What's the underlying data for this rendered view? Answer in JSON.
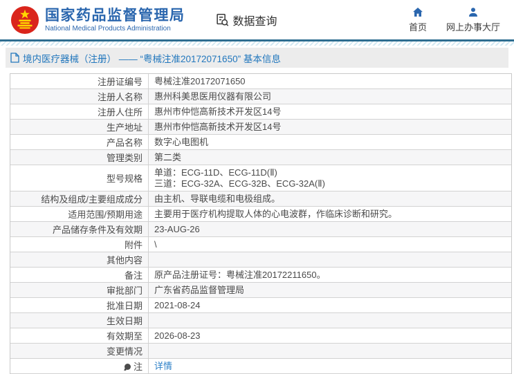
{
  "header": {
    "logo_title": "国家药品监督管理局",
    "logo_subtitle": "National Medical Products Administration",
    "logo_icon": "national-emblem-icon",
    "data_query": {
      "label": "数据查询",
      "icon": "document-search-icon"
    },
    "nav": [
      {
        "label": "首页",
        "icon": "home-icon"
      },
      {
        "label": "网上办事大厅",
        "icon": "person-icon"
      }
    ]
  },
  "section": {
    "icon": "document-icon",
    "title": "境内医疗器械（注册） —— “粤械注准20172071650” 基本信息"
  },
  "table": {
    "rows": [
      {
        "label": "注册证编号",
        "value": "粤械注准20172071650"
      },
      {
        "label": "注册人名称",
        "value": "惠州科美思医用仪器有限公司"
      },
      {
        "label": "注册人住所",
        "value": "惠州市仲恺高新技术开发区14号"
      },
      {
        "label": "生产地址",
        "value": "惠州市仲恺高新技术开发区14号"
      },
      {
        "label": "产品名称",
        "value": "数字心电图机"
      },
      {
        "label": "管理类别",
        "value": "第二类"
      },
      {
        "label": "型号规格",
        "value": "单道：ECG-11D、ECG-11D(Ⅱ)\n三道：ECG-32A、ECG-32B、ECG-32A(Ⅱ)"
      },
      {
        "label": "结构及组成/主要组成成分",
        "value": "由主机、导联电缆和电极组成。"
      },
      {
        "label": "适用范围/预期用途",
        "value": "主要用于医疗机构提取人体的心电波群，作临床诊断和研究。"
      },
      {
        "label": "产品储存条件及有效期",
        "value": "23-AUG-26"
      },
      {
        "label": "附件",
        "value": "\\"
      },
      {
        "label": "其他内容",
        "value": ""
      },
      {
        "label": "备注",
        "value": "原产品注册证号：粤械注准20172211650。"
      },
      {
        "label": "审批部门",
        "value": "广东省药品监督管理局"
      },
      {
        "label": "批准日期",
        "value": "2021-08-24"
      },
      {
        "label": "生效日期",
        "value": ""
      },
      {
        "label": "有效期至",
        "value": "2026-08-23"
      },
      {
        "label": "变更情况",
        "value": ""
      },
      {
        "label": "注",
        "value": "详情",
        "is_link": true,
        "label_icon": "note-icon"
      }
    ]
  },
  "colors": {
    "brand_blue": "#2a66ae",
    "link_blue": "#2e81c8",
    "section_title_blue": "#2277bd",
    "divider_teal": "#2e6d90",
    "emblem_red": "#da251c",
    "emblem_yellow": "#ffd700",
    "row_alt_bg": "#f6f6f7",
    "border_gray": "#d2d2d2"
  }
}
